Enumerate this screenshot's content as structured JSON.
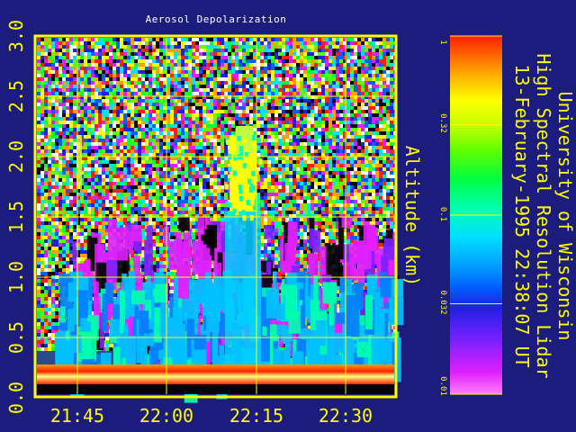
{
  "chart_data": {
    "type": "heatmap",
    "title": "Aerosol Depolarization",
    "ylabel": "Altitude (km)",
    "ylim": [
      0.0,
      3.0
    ],
    "yticks": [
      "0.0",
      "0.5",
      "1.0",
      "1.5",
      "2.0",
      "2.5",
      "3.0"
    ],
    "xticks": [
      "21:45",
      "22:00",
      "22:15",
      "22:30"
    ],
    "colorbar": {
      "scale": "log",
      "range": [
        0.01,
        1
      ],
      "ticks": [
        "0.01",
        "0.032",
        "0.1",
        "0.32",
        "1"
      ]
    }
  },
  "info_lines": [
    "University of Wisconsin",
    "High Spectral Resolution Lidar",
    "13-February-1995 22:38:07 UT"
  ],
  "colors": {
    "background": "#1c1c7c",
    "frame": "#ffff00",
    "text": "#ffff00",
    "title_text": "#ffffff"
  }
}
